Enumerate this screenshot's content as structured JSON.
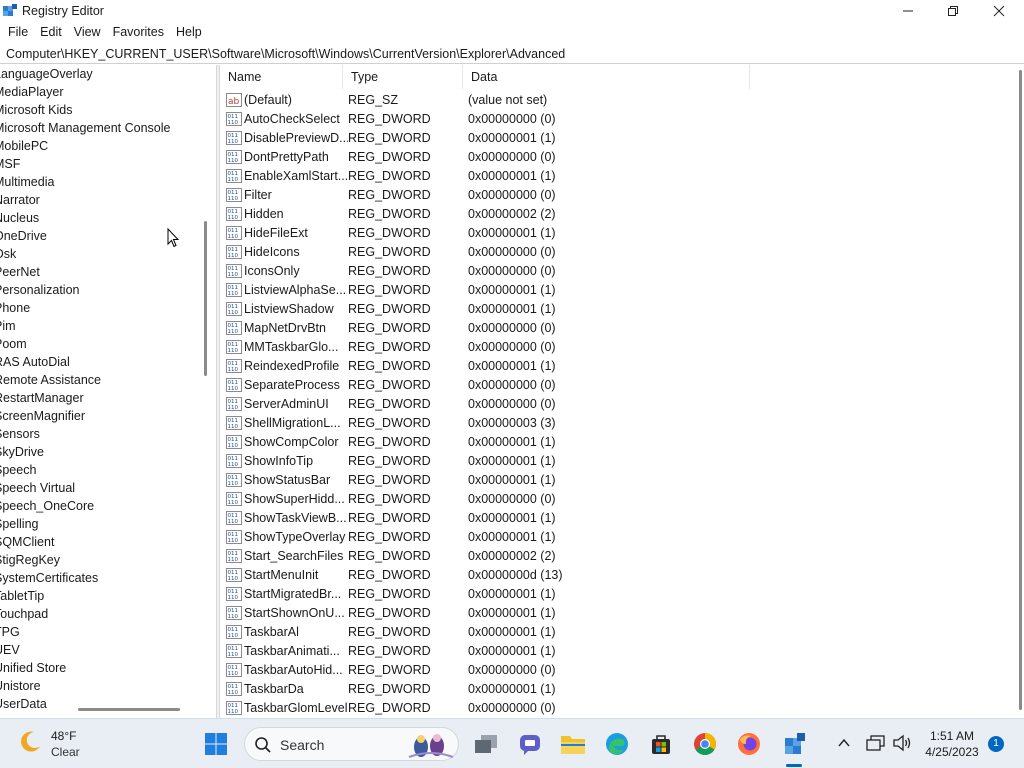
{
  "window": {
    "title": "Registry Editor"
  },
  "menu": [
    "File",
    "Edit",
    "View",
    "Favorites",
    "Help"
  ],
  "address": "Computer\\HKEY_CURRENT_USER\\Software\\Microsoft\\Windows\\CurrentVersion\\Explorer\\Advanced",
  "tree": [
    "LanguageOverlay",
    "MediaPlayer",
    "Microsoft Kids",
    "Microsoft Management Console",
    "MobilePC",
    "MSF",
    "Multimedia",
    "Narrator",
    "Nucleus",
    "OneDrive",
    "Osk",
    "PeerNet",
    "Personalization",
    "Phone",
    "Pim",
    "Poom",
    "RAS AutoDial",
    "Remote Assistance",
    "RestartManager",
    "ScreenMagnifier",
    "Sensors",
    "SkyDrive",
    "Speech",
    "Speech Virtual",
    "Speech_OneCore",
    "Spelling",
    "SQMClient",
    "StigRegKey",
    "SystemCertificates",
    "TabletTip",
    "Touchpad",
    "TPG",
    "UEV",
    "Unified Store",
    "Unistore",
    "UserData"
  ],
  "columns": {
    "name": "Name",
    "type": "Type",
    "data": "Data"
  },
  "values": [
    {
      "name": "(Default)",
      "type": "REG_SZ",
      "data": "(value not set)",
      "icon": "string"
    },
    {
      "name": "AutoCheckSelect",
      "type": "REG_DWORD",
      "data": "0x00000000 (0)",
      "icon": "binary"
    },
    {
      "name": "DisablePreviewD...",
      "type": "REG_DWORD",
      "data": "0x00000001 (1)",
      "icon": "binary"
    },
    {
      "name": "DontPrettyPath",
      "type": "REG_DWORD",
      "data": "0x00000000 (0)",
      "icon": "binary"
    },
    {
      "name": "EnableXamlStart...",
      "type": "REG_DWORD",
      "data": "0x00000001 (1)",
      "icon": "binary"
    },
    {
      "name": "Filter",
      "type": "REG_DWORD",
      "data": "0x00000000 (0)",
      "icon": "binary"
    },
    {
      "name": "Hidden",
      "type": "REG_DWORD",
      "data": "0x00000002 (2)",
      "icon": "binary"
    },
    {
      "name": "HideFileExt",
      "type": "REG_DWORD",
      "data": "0x00000001 (1)",
      "icon": "binary"
    },
    {
      "name": "HideIcons",
      "type": "REG_DWORD",
      "data": "0x00000000 (0)",
      "icon": "binary"
    },
    {
      "name": "IconsOnly",
      "type": "REG_DWORD",
      "data": "0x00000000 (0)",
      "icon": "binary"
    },
    {
      "name": "ListviewAlphaSe...",
      "type": "REG_DWORD",
      "data": "0x00000001 (1)",
      "icon": "binary"
    },
    {
      "name": "ListviewShadow",
      "type": "REG_DWORD",
      "data": "0x00000001 (1)",
      "icon": "binary"
    },
    {
      "name": "MapNetDrvBtn",
      "type": "REG_DWORD",
      "data": "0x00000000 (0)",
      "icon": "binary"
    },
    {
      "name": "MMTaskbarGlo...",
      "type": "REG_DWORD",
      "data": "0x00000000 (0)",
      "icon": "binary"
    },
    {
      "name": "ReindexedProfile",
      "type": "REG_DWORD",
      "data": "0x00000001 (1)",
      "icon": "binary"
    },
    {
      "name": "SeparateProcess",
      "type": "REG_DWORD",
      "data": "0x00000000 (0)",
      "icon": "binary"
    },
    {
      "name": "ServerAdminUI",
      "type": "REG_DWORD",
      "data": "0x00000000 (0)",
      "icon": "binary"
    },
    {
      "name": "ShellMigrationL...",
      "type": "REG_DWORD",
      "data": "0x00000003 (3)",
      "icon": "binary"
    },
    {
      "name": "ShowCompColor",
      "type": "REG_DWORD",
      "data": "0x00000001 (1)",
      "icon": "binary"
    },
    {
      "name": "ShowInfoTip",
      "type": "REG_DWORD",
      "data": "0x00000001 (1)",
      "icon": "binary"
    },
    {
      "name": "ShowStatusBar",
      "type": "REG_DWORD",
      "data": "0x00000001 (1)",
      "icon": "binary"
    },
    {
      "name": "ShowSuperHidd...",
      "type": "REG_DWORD",
      "data": "0x00000000 (0)",
      "icon": "binary"
    },
    {
      "name": "ShowTaskViewB...",
      "type": "REG_DWORD",
      "data": "0x00000001 (1)",
      "icon": "binary"
    },
    {
      "name": "ShowTypeOverlay",
      "type": "REG_DWORD",
      "data": "0x00000001 (1)",
      "icon": "binary"
    },
    {
      "name": "Start_SearchFiles",
      "type": "REG_DWORD",
      "data": "0x00000002 (2)",
      "icon": "binary"
    },
    {
      "name": "StartMenuInit",
      "type": "REG_DWORD",
      "data": "0x0000000d (13)",
      "icon": "binary"
    },
    {
      "name": "StartMigratedBr...",
      "type": "REG_DWORD",
      "data": "0x00000001 (1)",
      "icon": "binary"
    },
    {
      "name": "StartShownOnU...",
      "type": "REG_DWORD",
      "data": "0x00000001 (1)",
      "icon": "binary"
    },
    {
      "name": "TaskbarAl",
      "type": "REG_DWORD",
      "data": "0x00000001 (1)",
      "icon": "binary"
    },
    {
      "name": "TaskbarAnimati...",
      "type": "REG_DWORD",
      "data": "0x00000001 (1)",
      "icon": "binary"
    },
    {
      "name": "TaskbarAutoHid...",
      "type": "REG_DWORD",
      "data": "0x00000000 (0)",
      "icon": "binary"
    },
    {
      "name": "TaskbarDa",
      "type": "REG_DWORD",
      "data": "0x00000001 (1)",
      "icon": "binary"
    },
    {
      "name": "TaskbarGlomLevel",
      "type": "REG_DWORD",
      "data": "0x00000000 (0)",
      "icon": "binary"
    }
  ],
  "taskbar": {
    "weather": {
      "temp": "48°F",
      "desc": "Clear",
      "icon": "moon-icon"
    },
    "search_label": "Search",
    "apps": [
      "start",
      "search",
      "task-view",
      "teams",
      "file-explorer",
      "edge",
      "store",
      "chrome",
      "firefox",
      "registry-editor"
    ],
    "clock": {
      "time": "1:51 AM",
      "date": "4/25/2023"
    },
    "notifications": "1"
  }
}
